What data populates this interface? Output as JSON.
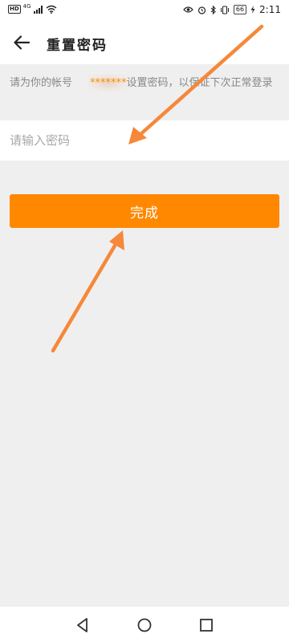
{
  "status_bar": {
    "network_badge": "HD",
    "signal_label": "4G",
    "battery_level": "66",
    "time": "2:11"
  },
  "app_bar": {
    "title": "重置密码"
  },
  "hint": {
    "prefix": "请为你的帐号",
    "masked_account": "*******",
    "suffix": "设置密码，以保证下次正常登录"
  },
  "password_field": {
    "placeholder": "请输入密码",
    "value": ""
  },
  "done_button": {
    "label": "完成"
  },
  "colors": {
    "accent": "#ff8800",
    "arrow": "#f5883a",
    "background": "#efefef"
  },
  "icons": {
    "back": "arrow-left-icon",
    "nav_back": "triangle-back-icon",
    "nav_home": "circle-home-icon",
    "nav_recents": "square-recents-icon"
  }
}
